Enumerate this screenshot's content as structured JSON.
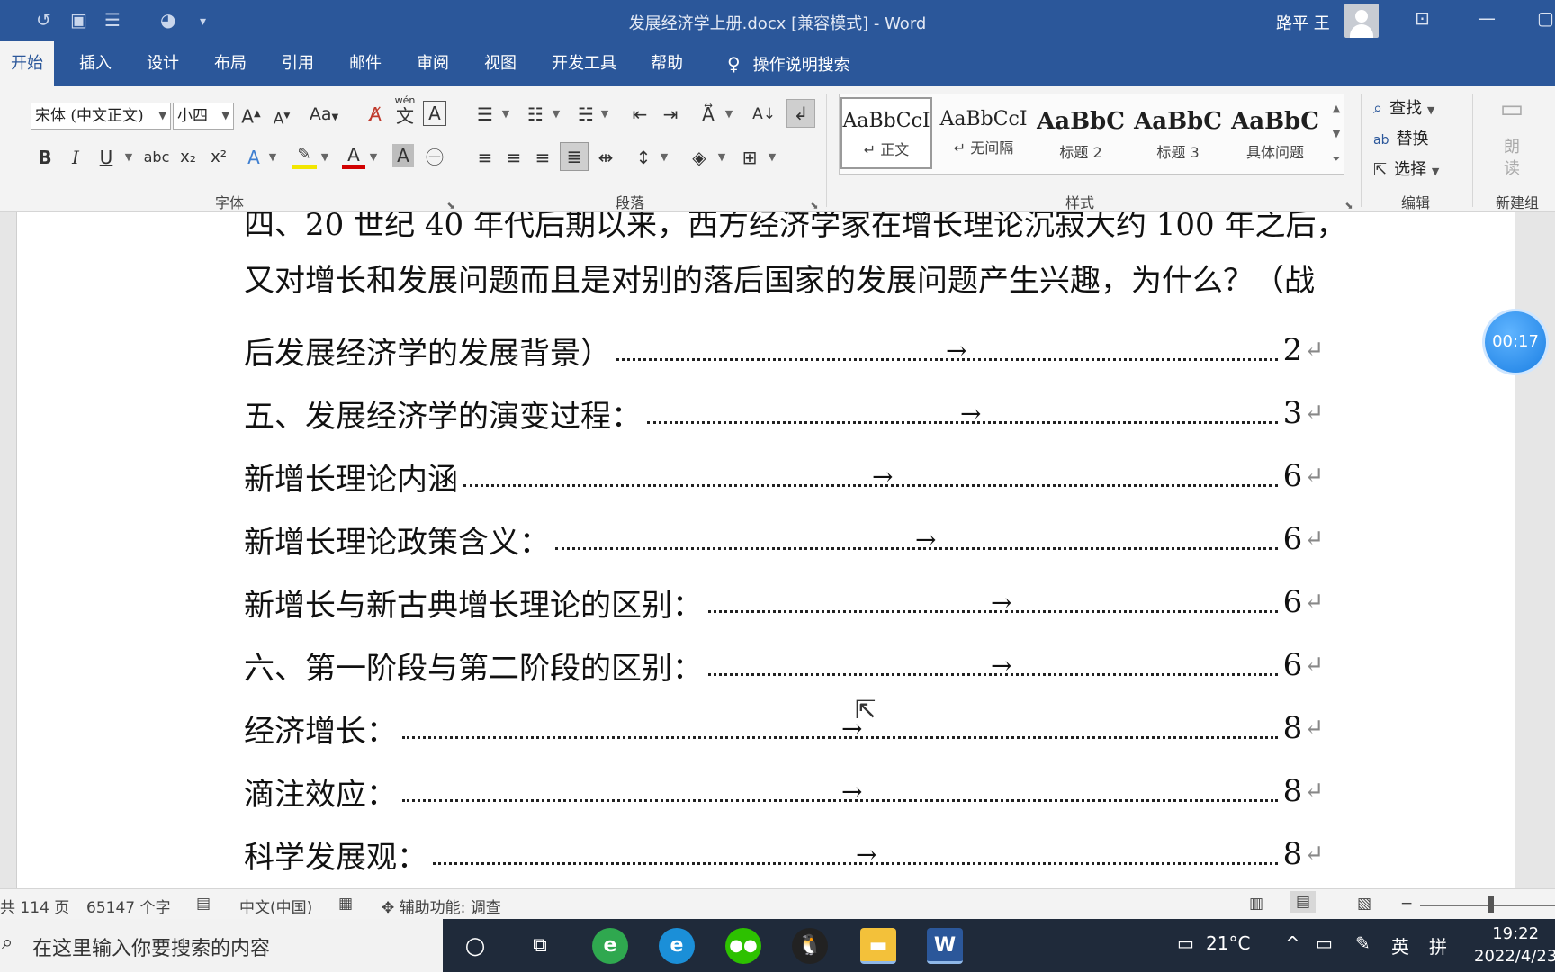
{
  "titlebar": {
    "title": "发展经济学上册.docx [兼容模式]  -  Word",
    "user": "路平 王"
  },
  "tabs": [
    "开始",
    "插入",
    "设计",
    "布局",
    "引用",
    "邮件",
    "审阅",
    "视图",
    "开发工具",
    "帮助"
  ],
  "tell_me": "操作说明搜索",
  "font": {
    "name": "宋体 (中文正文)",
    "size": "小四",
    "case_label": "Aa",
    "phonetic_top": "wén",
    "phonetic_char": "文",
    "bold": "B",
    "italic": "I",
    "underline": "U",
    "strike": "abc",
    "sub": "x₂",
    "sup": "x²",
    "effects": "A",
    "group_label": "字体"
  },
  "paragraph": {
    "group_label": "段落"
  },
  "styles": {
    "group_label": "样式",
    "items": [
      {
        "sample": "AaBbCcI",
        "name": "↵ 正文"
      },
      {
        "sample": "AaBbCcI",
        "name": "↵ 无间隔"
      },
      {
        "sample": "AaBbC",
        "name": "标题 2"
      },
      {
        "sample": "AaBbC",
        "name": "标题 3"
      },
      {
        "sample": "AaBbC",
        "name": "具体问题"
      }
    ]
  },
  "editing": {
    "find": "查找",
    "replace": "替换",
    "select": "选择",
    "group_label": "编辑"
  },
  "voice": {
    "label1": "朗",
    "label2": "读",
    "group_label": "新建组"
  },
  "document": {
    "lines": [
      {
        "text": "四、20 世纪 40 年代后期以来，西方经济学家在增长理论沉寂大约 100 年之后，",
        "page": ""
      },
      {
        "text": "又对增长和发展问题而且是对别的落后国家的发展问题产生兴趣，为什么？（战",
        "page": ""
      },
      {
        "text": "后发展经济学的发展背景）",
        "page": "2"
      },
      {
        "text": "五、发展经济学的演变过程：",
        "page": "3"
      },
      {
        "text": "新增长理论内涵",
        "page": "6"
      },
      {
        "text": "新增长理论政策含义：",
        "page": "6"
      },
      {
        "text": "新增长与新古典增长理论的区别：",
        "page": "6"
      },
      {
        "text": "六、第一阶段与第二阶段的区别：",
        "page": "6"
      },
      {
        "text": "经济增长：",
        "page": "8"
      },
      {
        "text": "滴注效应：",
        "page": "8"
      },
      {
        "text": "科学发展观：",
        "page": "8"
      }
    ],
    "tab_arrow": "→",
    "para_mark": "↵"
  },
  "timer": "00:17",
  "status": {
    "pages": "共 114 页",
    "words": "65147 个字",
    "lang": "中文(中国)",
    "accessibility": "辅助功能: 调查"
  },
  "taskbar": {
    "search_placeholder": "在这里输入你要搜索的内容",
    "temperature": "21°C",
    "ime": "英",
    "ime2": "拼",
    "time": "19:22",
    "date": "2022/4/23"
  },
  "colors": {
    "word_blue": "#2b579a",
    "ribbon_bg": "#f3f3f3",
    "taskbar": "#1f2a3a"
  }
}
